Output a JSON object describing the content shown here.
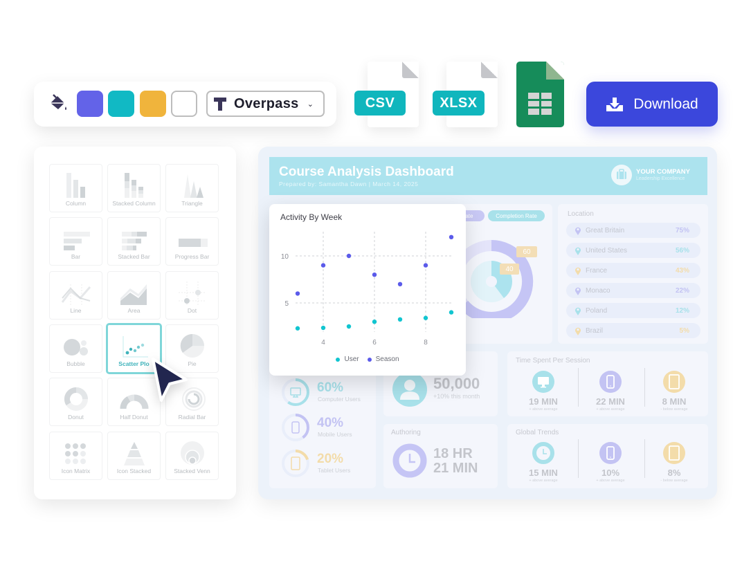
{
  "toolbar": {
    "paint_icon": "paint-bucket-icon",
    "swatches": [
      {
        "name": "purple",
        "color": "#6363e8"
      },
      {
        "name": "teal",
        "color": "#11b9c4"
      },
      {
        "name": "amber",
        "color": "#f0b43c"
      },
      {
        "name": "white",
        "color": "#ffffff"
      }
    ],
    "font": {
      "icon": "text-T-icon",
      "selected": "Overpass",
      "chevron": "chevron-down-icon"
    }
  },
  "exports": {
    "formats": [
      {
        "label": "CSV",
        "icon": "file-icon"
      },
      {
        "label": "XLSX",
        "icon": "file-icon"
      },
      {
        "label": "Google Sheets",
        "icon": "sheets-icon"
      }
    ],
    "download_label": "Download",
    "download_icon": "download-tray-icon",
    "download_color": "#3b47dc"
  },
  "chart_types": {
    "selected": "Scatter Plot",
    "items": [
      {
        "label": "Column"
      },
      {
        "label": "Stacked Column"
      },
      {
        "label": "Triangle"
      },
      {
        "label": "Bar"
      },
      {
        "label": "Stacked Bar"
      },
      {
        "label": "Progress Bar"
      },
      {
        "label": "Line"
      },
      {
        "label": "Area"
      },
      {
        "label": "Dot"
      },
      {
        "label": "Bubble"
      },
      {
        "label": "Scatter Plo"
      },
      {
        "label": "Pie"
      },
      {
        "label": "Donut"
      },
      {
        "label": "Half Donut"
      },
      {
        "label": "Radial Bar"
      },
      {
        "label": "Icon Matrix"
      },
      {
        "label": "Icon Stacked"
      },
      {
        "label": "Stacked Venn"
      }
    ]
  },
  "dashboard": {
    "title": "Course Analysis Dashboard",
    "subtitle": "Prepared by:  Samantha Dawn | March 14, 2025",
    "company": "YOUR COMPANY",
    "tagline": "Leadership Excellence",
    "rate_pills": [
      "Rate",
      "Completion Rate"
    ],
    "donut_labels": [
      "60",
      "40"
    ],
    "location": {
      "title": "Location",
      "rows": [
        {
          "country": "Great Britain",
          "pct": "75%",
          "color": "#c3c3f3"
        },
        {
          "country": "United States",
          "pct": "56%",
          "color": "#a8e1ea"
        },
        {
          "country": "France",
          "pct": "43%",
          "color": "#f3dcaa"
        },
        {
          "country": "Monaco",
          "pct": "22%",
          "color": "#c3c3f3"
        },
        {
          "country": "Poland",
          "pct": "12%",
          "color": "#a8e1ea"
        },
        {
          "country": "Brazil",
          "pct": "5%",
          "color": "#f3dcaa"
        }
      ]
    },
    "devices": [
      {
        "value": "60%",
        "label": "Computer Users",
        "color": "#a8e1ea"
      },
      {
        "value": "40%",
        "label": "Mobile Users",
        "color": "#c3c3f3"
      },
      {
        "value": "20%",
        "label": "Tablet Users",
        "color": "#f3dcaa"
      }
    ],
    "users": {
      "value": "50,000",
      "note": "+10% this month"
    },
    "authoring": {
      "title": "Authoring",
      "line1": "18 HR",
      "line2": "21 MIN"
    },
    "time_per_session": {
      "title": "Time Spent Per Session",
      "items": [
        {
          "value": "19 MIN",
          "note": "+ above average",
          "icon": "monitor-icon",
          "color": "#a8e1ea"
        },
        {
          "value": "22 MIN",
          "note": "+ above average",
          "icon": "phone-icon",
          "color": "#c3c3f3"
        },
        {
          "value": "8 MIN",
          "note": "- below average",
          "icon": "tablet-icon",
          "color": "#f3dcaa"
        }
      ]
    },
    "global_trends": {
      "title": "Global Trends",
      "items": [
        {
          "value": "15 MIN",
          "note": "+ above average",
          "icon": "clock-icon",
          "color": "#a8e1ea"
        },
        {
          "value": "10%",
          "note": "+ above average",
          "icon": "phone-icon",
          "color": "#c3c3f3"
        },
        {
          "value": "8%",
          "note": "- below average",
          "icon": "tablet-icon",
          "color": "#f3dcaa"
        }
      ]
    }
  },
  "chart_data": {
    "type": "scatter",
    "title": "Activity By Week",
    "xlabel": "",
    "ylabel": "",
    "xlim": [
      3,
      9
    ],
    "ylim": [
      1.5,
      12
    ],
    "xticks": [
      4,
      6,
      8
    ],
    "yticks": [
      5,
      10
    ],
    "grid": true,
    "legend": "bottom",
    "series": [
      {
        "name": "User",
        "color": "#11c5d0",
        "x": [
          3,
          4,
          5,
          6,
          7,
          8,
          9
        ],
        "y": [
          2.3,
          2.35,
          2.5,
          3.0,
          3.25,
          3.4,
          4.0
        ]
      },
      {
        "name": "Season",
        "color": "#5b5bea",
        "x": [
          3,
          4,
          5,
          6,
          7,
          8,
          9
        ],
        "y": [
          6,
          9,
          10,
          8,
          7,
          9,
          12
        ]
      }
    ]
  }
}
